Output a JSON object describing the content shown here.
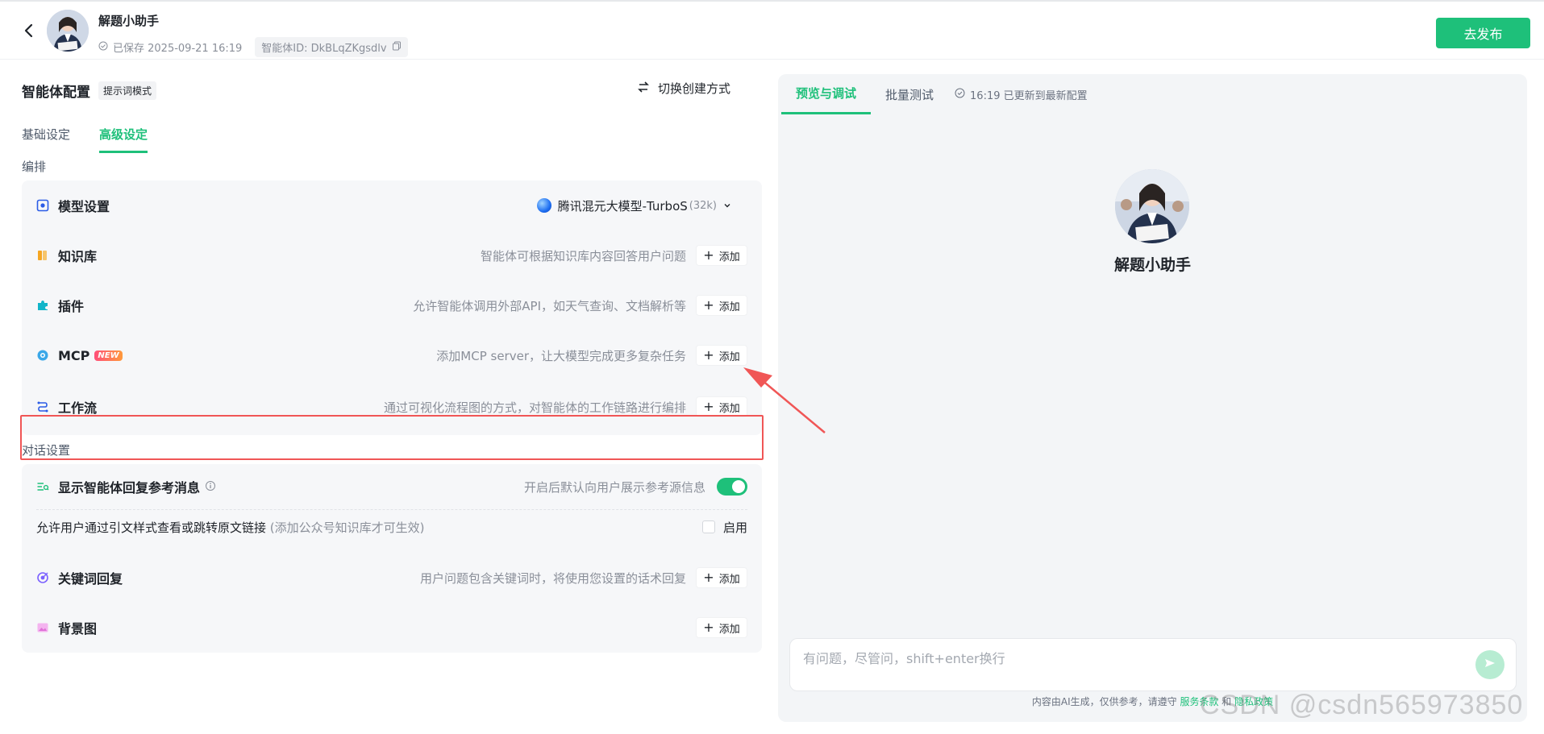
{
  "header": {
    "title": "解题小助手",
    "saved_text": "已保存 2025-09-21 16:19",
    "agent_id_label": "智能体ID: DkBLqZKgsdlv",
    "publish_label": "去发布"
  },
  "config": {
    "title": "智能体配置",
    "mode_badge": "提示词模式",
    "switch_label": "切换创建方式",
    "tabs": [
      {
        "label": "基础设定",
        "active": false
      },
      {
        "label": "高级设定",
        "active": true
      }
    ],
    "section_orchestration": "编排",
    "model_row": {
      "name": "模型设置",
      "model": "腾讯混元大模型-TurboS",
      "context": "(32k)"
    },
    "rows": [
      {
        "name": "知识库",
        "desc": "智能体可根据知识库内容回答用户问题",
        "add": "添加"
      },
      {
        "name": "插件",
        "desc": "允许智能体调用外部API，如天气查询、文档解析等",
        "add": "添加"
      },
      {
        "name": "MCP",
        "badge": "NEW",
        "desc": "添加MCP server，让大模型完成更多复杂任务",
        "add": "添加"
      },
      {
        "name": "工作流",
        "desc": "通过可视化流程图的方式，对智能体的工作链路进行编排",
        "add": "添加"
      }
    ],
    "section_dialogue": "对话设置",
    "ref_row": {
      "name": "显示智能体回复参考消息",
      "desc": "开启后默认向用户展示参考源信息",
      "toggle_on": true
    },
    "link_row": {
      "text": "允许用户通过引文样式查看或跳转原文链接",
      "hint": "(添加公众号知识库才可生效)",
      "enable_label": "启用"
    },
    "keyword_row": {
      "name": "关键词回复",
      "desc": "用户问题包含关键词时，将使用您设置的话术回复",
      "add": "添加"
    },
    "bg_row": {
      "name": "背景图",
      "add": "添加"
    }
  },
  "preview": {
    "tabs": [
      {
        "label": "预览与调试",
        "active": true
      },
      {
        "label": "批量测试",
        "active": false
      }
    ],
    "status": "16:19 已更新到最新配置",
    "bot_name": "解题小助手",
    "input_placeholder": "有问题，尽管问，shift+enter换行",
    "footnote_prefix": "内容由AI生成，仅供参考，请遵守",
    "footnote_link1": "服务条款",
    "footnote_and": "和",
    "footnote_link2": "隐私政策"
  },
  "watermark": "CSDN @csdn565973850",
  "colors": {
    "accent": "#1ec07a",
    "highlight": "#f05656"
  }
}
